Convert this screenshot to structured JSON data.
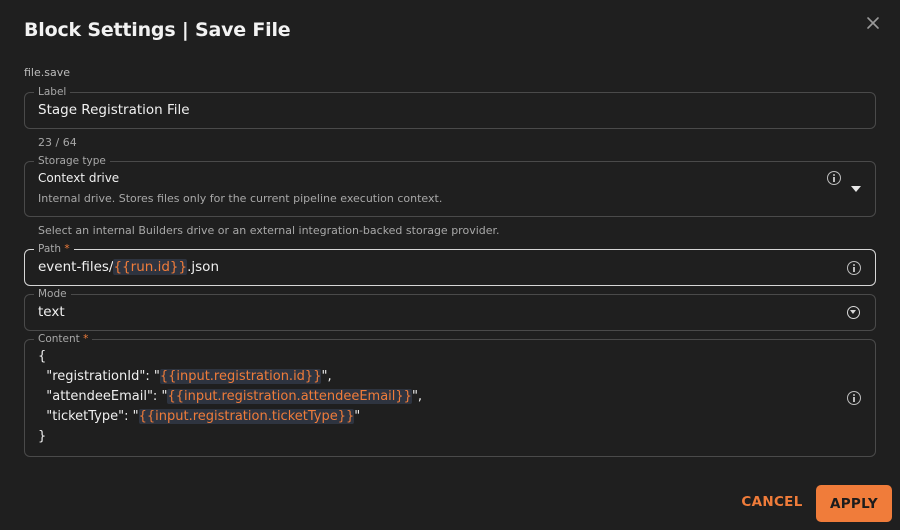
{
  "dialog": {
    "title": "Block Settings | Save File",
    "block_type": "file.save"
  },
  "label_field": {
    "label": "Label",
    "value": "Stage Registration File",
    "counter": "23 / 64"
  },
  "storage_field": {
    "label": "Storage type",
    "selected": "Context drive",
    "description": "Internal drive. Stores files only for the current pipeline execution context.",
    "helper": "Select an internal Builders drive or an external integration-backed storage provider."
  },
  "path_field": {
    "label": "Path",
    "required_mark": "*",
    "prefix": "event-files/",
    "token": "{{run.id}}",
    "suffix": ".json"
  },
  "mode_field": {
    "label": "Mode",
    "selected": "text"
  },
  "content_field": {
    "label": "Content",
    "required_mark": "*",
    "lines": [
      {
        "pre": "{",
        "token": "",
        "post": ""
      },
      {
        "pre": "  \"registrationId\": \"",
        "token": "{{input.registration.id}}",
        "post": "\","
      },
      {
        "pre": "  \"attendeeEmail\": \"",
        "token": "{{input.registration.attendeeEmail}}",
        "post": "\","
      },
      {
        "pre": "  \"ticketType\": \"",
        "token": "{{input.registration.ticketType}}",
        "post": "\""
      },
      {
        "pre": "}",
        "token": "",
        "post": ""
      }
    ]
  },
  "actions": {
    "cancel_label": "CANCEL",
    "apply_label": "APPLY"
  },
  "colors": {
    "accent": "#f07c3a",
    "background": "#1f1f1f",
    "token_bg": "#2e3440"
  },
  "icons": {
    "close": "close-icon",
    "info": "info-icon",
    "dropdown": "chevron-down-icon"
  }
}
